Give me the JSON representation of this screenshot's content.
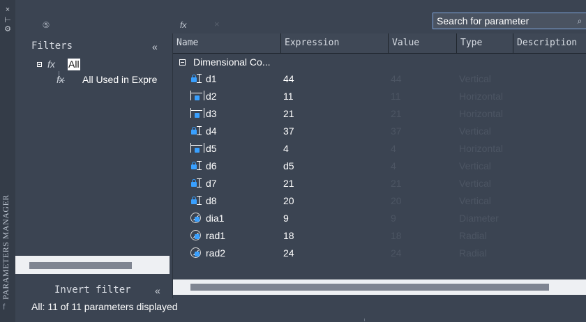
{
  "window": {
    "vertical_title": "PARAMETERS MANAGER"
  },
  "toolbar": {
    "search": {
      "value": "Search for parameter",
      "placeholder": "Search for parameter"
    }
  },
  "filters": {
    "title": "Filters",
    "collapse_glyph": "«",
    "tree": {
      "root_label": "All",
      "child_label": "All Used in Expre"
    },
    "invert_label": "Invert filter",
    "invert_glyph": "«"
  },
  "grid": {
    "columns": [
      "Name",
      "Expression",
      "Value",
      "Type",
      "Description"
    ],
    "group": "Dimensional Co...",
    "rows": [
      {
        "icon": "vertical-lock-icon",
        "name": "d1",
        "expression": "44",
        "value": "44",
        "type": "Vertical"
      },
      {
        "icon": "horizontal-lock-icon",
        "name": "d2",
        "expression": "11",
        "value": "11",
        "type": "Horizontal"
      },
      {
        "icon": "horizontal-lock-icon",
        "name": "d3",
        "expression": "21",
        "value": "21",
        "type": "Horizontal"
      },
      {
        "icon": "vertical-lock-icon",
        "name": "d4",
        "expression": "37",
        "value": "37",
        "type": "Vertical"
      },
      {
        "icon": "horizontal-lock-icon",
        "name": "d5",
        "expression": "4",
        "value": "4",
        "type": "Horizontal"
      },
      {
        "icon": "vertical-lock-icon",
        "name": "d6",
        "expression": "d5",
        "value": "4",
        "type": "Vertical"
      },
      {
        "icon": "vertical-lock-icon",
        "name": "d7",
        "expression": "21",
        "value": "21",
        "type": "Vertical"
      },
      {
        "icon": "vertical-lock-icon",
        "name": "d8",
        "expression": "20",
        "value": "20",
        "type": "Vertical"
      },
      {
        "icon": "diameter-icon",
        "name": "dia1",
        "expression": "9",
        "value": "9",
        "type": "Diameter"
      },
      {
        "icon": "radial-icon",
        "name": "rad1",
        "expression": "18",
        "value": "18",
        "type": "Radial"
      },
      {
        "icon": "radial-icon",
        "name": "rad2",
        "expression": "24",
        "value": "24",
        "type": "Radial"
      }
    ]
  },
  "status": {
    "text": "All: 11 of 11 parameters displayed"
  },
  "icons": {
    "close": "close-icon",
    "pin": "pin-icon",
    "settings": "gear-icon",
    "function": "function-icon",
    "search": "search-icon"
  },
  "colors": {
    "panel": "#3b4452",
    "accent": "#39a0ff",
    "muted": "#4c5563"
  }
}
